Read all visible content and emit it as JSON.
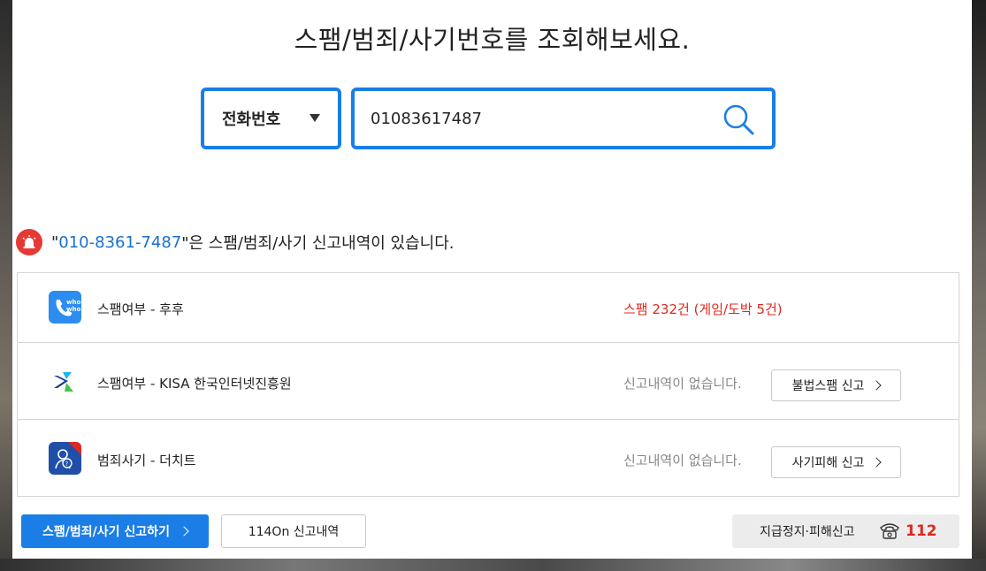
{
  "page": {
    "title": "스팸/범죄/사기번호를 조회해보세요."
  },
  "search": {
    "type_selected": "전화번호",
    "query_value": "01083617487"
  },
  "alert": {
    "quote_open": "\"",
    "number": "010-8361-7487",
    "message": "\"은 스팸/범죄/사기 신고내역이 있습니다."
  },
  "results": [
    {
      "label": "스팸여부 - 후후",
      "status": "스팸 232건 (게임/도박 5건)",
      "icon": "whowho-phone-icon",
      "status_color": "#e0281e"
    },
    {
      "label": "스팸여부 - KISA 한국인터넷진흥원",
      "status": "신고내역이 없습니다.",
      "icon": "kisa-logo-icon",
      "button": "불법스팸 신고"
    },
    {
      "label": "범죄사기 - 더치트",
      "status": "신고내역이 없습니다.",
      "icon": "thecheat-icon",
      "button": "사기피해 신고"
    }
  ],
  "footer": {
    "report_button": "스팸/범죄/사기 신고하기",
    "history_button": "114On 신고내역",
    "emergency_label": "지급정지·피해신고",
    "emergency_number": "112"
  },
  "colors": {
    "accent": "#1a7ee6",
    "alert_red": "#e53935",
    "spam_red": "#e0281e"
  }
}
